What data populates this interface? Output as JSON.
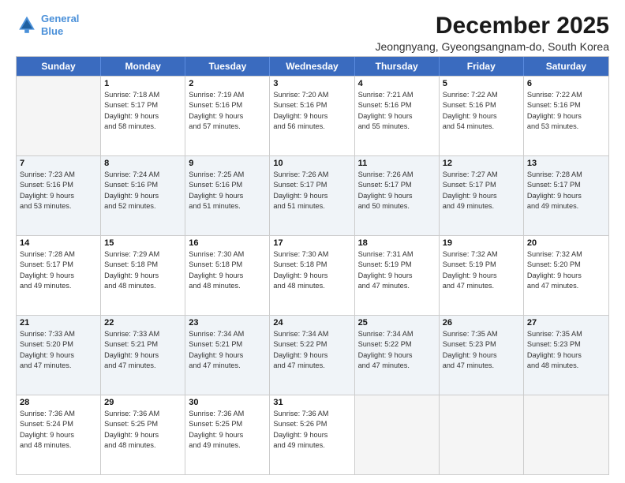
{
  "header": {
    "logo_line1": "General",
    "logo_line2": "Blue",
    "month_year": "December 2025",
    "location": "Jeongnyang, Gyeongsangnam-do, South Korea"
  },
  "day_headers": [
    "Sunday",
    "Monday",
    "Tuesday",
    "Wednesday",
    "Thursday",
    "Friday",
    "Saturday"
  ],
  "weeks": [
    [
      {
        "num": "",
        "lines": [],
        "empty": true
      },
      {
        "num": "1",
        "lines": [
          "Sunrise: 7:18 AM",
          "Sunset: 5:17 PM",
          "Daylight: 9 hours",
          "and 58 minutes."
        ]
      },
      {
        "num": "2",
        "lines": [
          "Sunrise: 7:19 AM",
          "Sunset: 5:16 PM",
          "Daylight: 9 hours",
          "and 57 minutes."
        ]
      },
      {
        "num": "3",
        "lines": [
          "Sunrise: 7:20 AM",
          "Sunset: 5:16 PM",
          "Daylight: 9 hours",
          "and 56 minutes."
        ]
      },
      {
        "num": "4",
        "lines": [
          "Sunrise: 7:21 AM",
          "Sunset: 5:16 PM",
          "Daylight: 9 hours",
          "and 55 minutes."
        ]
      },
      {
        "num": "5",
        "lines": [
          "Sunrise: 7:22 AM",
          "Sunset: 5:16 PM",
          "Daylight: 9 hours",
          "and 54 minutes."
        ]
      },
      {
        "num": "6",
        "lines": [
          "Sunrise: 7:22 AM",
          "Sunset: 5:16 PM",
          "Daylight: 9 hours",
          "and 53 minutes."
        ]
      }
    ],
    [
      {
        "num": "7",
        "lines": [
          "Sunrise: 7:23 AM",
          "Sunset: 5:16 PM",
          "Daylight: 9 hours",
          "and 53 minutes."
        ]
      },
      {
        "num": "8",
        "lines": [
          "Sunrise: 7:24 AM",
          "Sunset: 5:16 PM",
          "Daylight: 9 hours",
          "and 52 minutes."
        ]
      },
      {
        "num": "9",
        "lines": [
          "Sunrise: 7:25 AM",
          "Sunset: 5:16 PM",
          "Daylight: 9 hours",
          "and 51 minutes."
        ]
      },
      {
        "num": "10",
        "lines": [
          "Sunrise: 7:26 AM",
          "Sunset: 5:17 PM",
          "Daylight: 9 hours",
          "and 51 minutes."
        ]
      },
      {
        "num": "11",
        "lines": [
          "Sunrise: 7:26 AM",
          "Sunset: 5:17 PM",
          "Daylight: 9 hours",
          "and 50 minutes."
        ]
      },
      {
        "num": "12",
        "lines": [
          "Sunrise: 7:27 AM",
          "Sunset: 5:17 PM",
          "Daylight: 9 hours",
          "and 49 minutes."
        ]
      },
      {
        "num": "13",
        "lines": [
          "Sunrise: 7:28 AM",
          "Sunset: 5:17 PM",
          "Daylight: 9 hours",
          "and 49 minutes."
        ]
      }
    ],
    [
      {
        "num": "14",
        "lines": [
          "Sunrise: 7:28 AM",
          "Sunset: 5:17 PM",
          "Daylight: 9 hours",
          "and 49 minutes."
        ]
      },
      {
        "num": "15",
        "lines": [
          "Sunrise: 7:29 AM",
          "Sunset: 5:18 PM",
          "Daylight: 9 hours",
          "and 48 minutes."
        ]
      },
      {
        "num": "16",
        "lines": [
          "Sunrise: 7:30 AM",
          "Sunset: 5:18 PM",
          "Daylight: 9 hours",
          "and 48 minutes."
        ]
      },
      {
        "num": "17",
        "lines": [
          "Sunrise: 7:30 AM",
          "Sunset: 5:18 PM",
          "Daylight: 9 hours",
          "and 48 minutes."
        ]
      },
      {
        "num": "18",
        "lines": [
          "Sunrise: 7:31 AM",
          "Sunset: 5:19 PM",
          "Daylight: 9 hours",
          "and 47 minutes."
        ]
      },
      {
        "num": "19",
        "lines": [
          "Sunrise: 7:32 AM",
          "Sunset: 5:19 PM",
          "Daylight: 9 hours",
          "and 47 minutes."
        ]
      },
      {
        "num": "20",
        "lines": [
          "Sunrise: 7:32 AM",
          "Sunset: 5:20 PM",
          "Daylight: 9 hours",
          "and 47 minutes."
        ]
      }
    ],
    [
      {
        "num": "21",
        "lines": [
          "Sunrise: 7:33 AM",
          "Sunset: 5:20 PM",
          "Daylight: 9 hours",
          "and 47 minutes."
        ]
      },
      {
        "num": "22",
        "lines": [
          "Sunrise: 7:33 AM",
          "Sunset: 5:21 PM",
          "Daylight: 9 hours",
          "and 47 minutes."
        ]
      },
      {
        "num": "23",
        "lines": [
          "Sunrise: 7:34 AM",
          "Sunset: 5:21 PM",
          "Daylight: 9 hours",
          "and 47 minutes."
        ]
      },
      {
        "num": "24",
        "lines": [
          "Sunrise: 7:34 AM",
          "Sunset: 5:22 PM",
          "Daylight: 9 hours",
          "and 47 minutes."
        ]
      },
      {
        "num": "25",
        "lines": [
          "Sunrise: 7:34 AM",
          "Sunset: 5:22 PM",
          "Daylight: 9 hours",
          "and 47 minutes."
        ]
      },
      {
        "num": "26",
        "lines": [
          "Sunrise: 7:35 AM",
          "Sunset: 5:23 PM",
          "Daylight: 9 hours",
          "and 47 minutes."
        ]
      },
      {
        "num": "27",
        "lines": [
          "Sunrise: 7:35 AM",
          "Sunset: 5:23 PM",
          "Daylight: 9 hours",
          "and 48 minutes."
        ]
      }
    ],
    [
      {
        "num": "28",
        "lines": [
          "Sunrise: 7:36 AM",
          "Sunset: 5:24 PM",
          "Daylight: 9 hours",
          "and 48 minutes."
        ]
      },
      {
        "num": "29",
        "lines": [
          "Sunrise: 7:36 AM",
          "Sunset: 5:25 PM",
          "Daylight: 9 hours",
          "and 48 minutes."
        ]
      },
      {
        "num": "30",
        "lines": [
          "Sunrise: 7:36 AM",
          "Sunset: 5:25 PM",
          "Daylight: 9 hours",
          "and 49 minutes."
        ]
      },
      {
        "num": "31",
        "lines": [
          "Sunrise: 7:36 AM",
          "Sunset: 5:26 PM",
          "Daylight: 9 hours",
          "and 49 minutes."
        ]
      },
      {
        "num": "",
        "lines": [],
        "empty": true
      },
      {
        "num": "",
        "lines": [],
        "empty": true
      },
      {
        "num": "",
        "lines": [],
        "empty": true
      }
    ]
  ]
}
